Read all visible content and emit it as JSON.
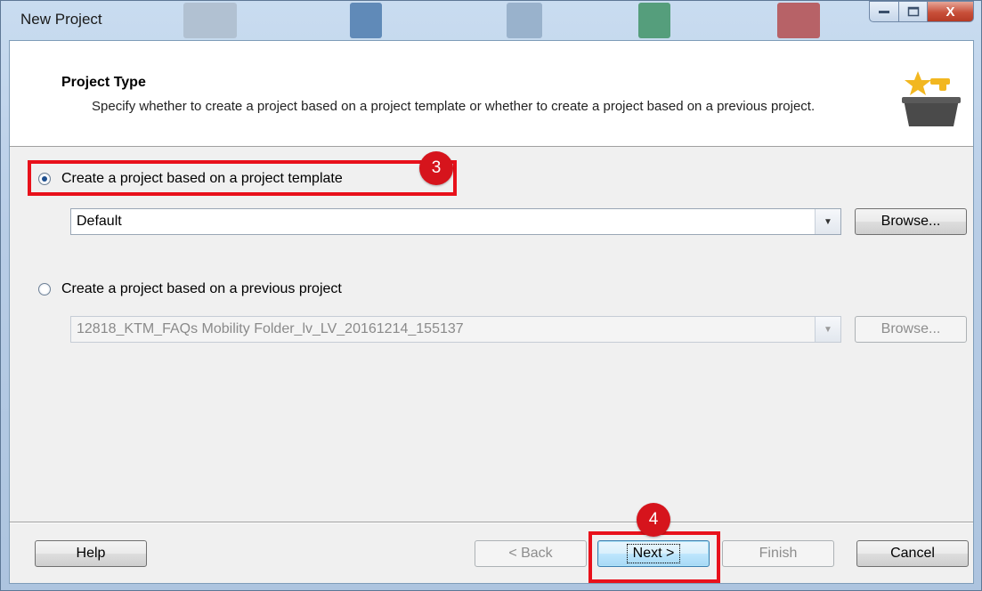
{
  "window": {
    "title": "New Project",
    "close_glyph": "X"
  },
  "header": {
    "title": "Project Type",
    "description": "Specify whether to create a project based on a project template or whether to create a project based on a previous project."
  },
  "options": {
    "template": {
      "label": "Create a project based on a project template",
      "selected": true,
      "combo_value": "Default",
      "browse_label": "Browse...",
      "enabled": true
    },
    "previous": {
      "label": "Create a project based on a previous project",
      "selected": false,
      "combo_value": "12818_KTM_FAQs Mobility Folder_lv_LV_20161214_155137",
      "browse_label": "Browse...",
      "enabled": false
    }
  },
  "footer": {
    "help_label": "Help",
    "back_label": "< Back",
    "next_label": "Next >",
    "finish_label": "Finish",
    "cancel_label": "Cancel"
  },
  "annotations": {
    "step3": "3",
    "step4": "4",
    "highlight_color": "#e8111b"
  }
}
